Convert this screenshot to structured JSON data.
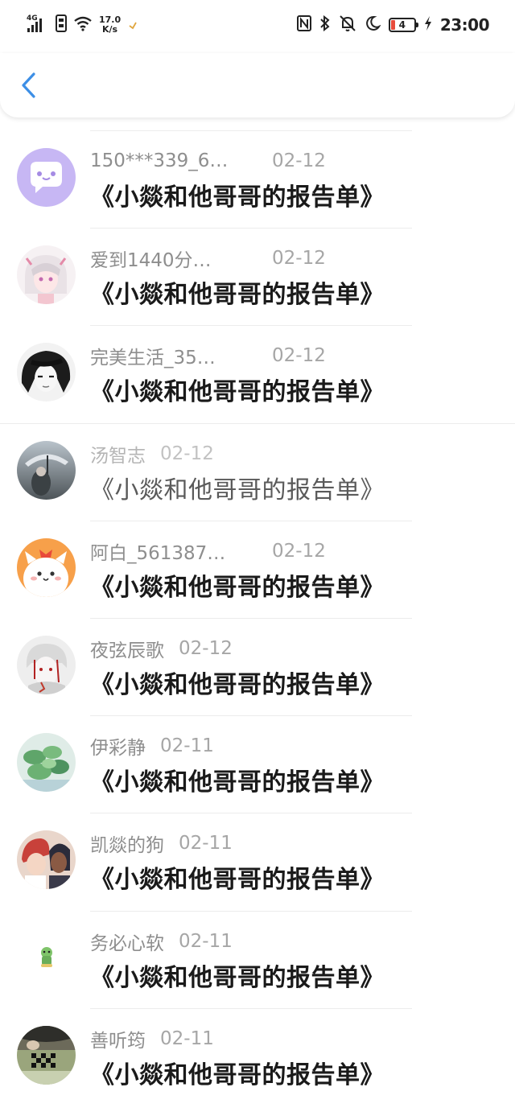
{
  "status_bar": {
    "network": "4G",
    "speed_value": "17.0",
    "speed_unit": "K/s",
    "battery": "4",
    "time": "23:00"
  },
  "header": {
    "back_icon": "chevron-left-icon",
    "accent_color": "#3d8fe6"
  },
  "items": [
    {
      "username": "150***339_6…",
      "date": "02-12",
      "title": "《小燚和他哥哥的报告单》"
    },
    {
      "username": "爱到1440分…",
      "date": "02-12",
      "title": "《小燚和他哥哥的报告单》"
    },
    {
      "username": "完美生活_35…",
      "date": "02-12",
      "title": "《小燚和他哥哥的报告单》"
    },
    {
      "username": "汤智志",
      "date": "02-12",
      "title": "《小燚和他哥哥的报告单》"
    },
    {
      "username": "阿白_561387…",
      "date": "02-12",
      "title": "《小燚和他哥哥的报告单》"
    },
    {
      "username": "夜弦辰歌",
      "date": "02-12",
      "title": "《小燚和他哥哥的报告单》"
    },
    {
      "username": "伊彩静",
      "date": "02-11",
      "title": "《小燚和他哥哥的报告单》"
    },
    {
      "username": "凯燚的狗",
      "date": "02-11",
      "title": "《小燚和他哥哥的报告单》"
    },
    {
      "username": "务必心软",
      "date": "02-11",
      "title": "《小燚和他哥哥的报告单》"
    },
    {
      "username": "善听筠",
      "date": "02-11",
      "title": "《小燚和他哥哥的报告单》"
    }
  ]
}
